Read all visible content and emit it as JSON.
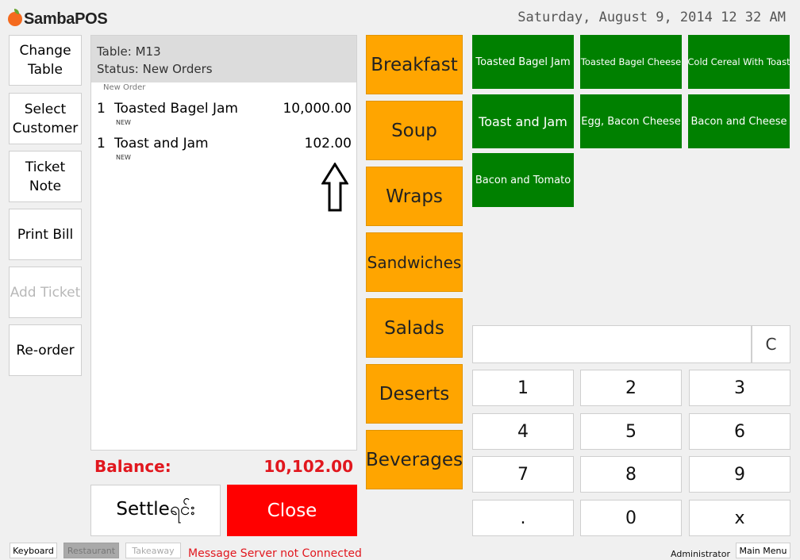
{
  "app": {
    "logo": "SambaPOS"
  },
  "header": {
    "datetime": "Saturday, August 9, 2014 12 32 AM"
  },
  "commands": {
    "change_table": "Change Table",
    "select_customer": "Select Customer",
    "ticket_note": "Ticket Note",
    "print_bill": "Print Bill",
    "add_ticket": "Add Ticket",
    "reorder": "Re-order"
  },
  "ticket": {
    "table": "Table: M13",
    "status": "Status: New Orders",
    "order_caption": "New Order",
    "lines": [
      {
        "qty": "1",
        "name": "Toasted Bagel Jam",
        "price": "10,000.00",
        "tag": "NEW"
      },
      {
        "qty": "1",
        "name": "Toast and Jam",
        "price": "102.00",
        "tag": "NEW"
      }
    ],
    "balance_label": "Balance:",
    "balance_value": "10,102.00",
    "settle": "Settleရင်း",
    "close": "Close"
  },
  "categories": [
    "Breakfast",
    "Soup",
    "Wraps",
    "Sandwiches",
    "Salads",
    "Deserts",
    "Beverages"
  ],
  "category_color": "#ffa500",
  "menu_items": [
    "Toasted Bagel Jam",
    "Toasted Bagel Cheese",
    "Cold Cereal With Toast",
    "Toast and Jam",
    "Egg, Bacon Cheese",
    "Bacon and Cheese",
    "Bacon and Tomato"
  ],
  "menu_item_color": "#008000",
  "numpad": {
    "display": "",
    "clear": "C",
    "keys": [
      "1",
      "2",
      "3",
      "4",
      "5",
      "6",
      "7",
      "8",
      "9",
      ".",
      "0",
      "x"
    ]
  },
  "footer": {
    "keyboard": "Keyboard",
    "restaurant": "Restaurant",
    "takeaway": "Takeaway",
    "message": "Message Server not Connected",
    "user": "Administrator",
    "main_menu": "Main Menu"
  },
  "annotation_icon": "up-arrow-icon"
}
